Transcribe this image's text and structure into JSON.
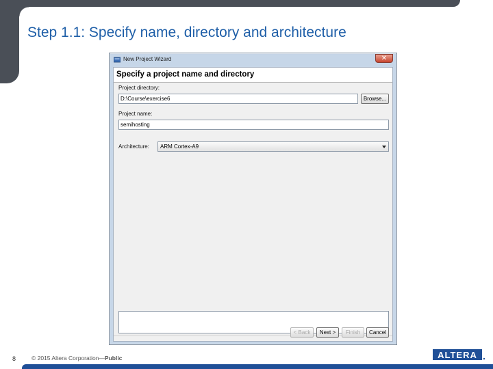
{
  "slide": {
    "title": "Step 1.1: Specify name, directory and architecture",
    "page_number": "8",
    "copyright_prefix": "© 2015 Altera Corporation—",
    "copyright_bold": "Public",
    "logo_text": "ALTERA"
  },
  "window": {
    "title": "New Project Wizard",
    "close_glyph": "✕",
    "header": "Specify a project name and directory",
    "project_directory_label": "Project directory:",
    "project_directory_value": "D:\\Course\\exercise6",
    "browse_label": "Browse...",
    "project_name_label": "Project name:",
    "project_name_value": "semihosting",
    "architecture_label": "Architecture:",
    "architecture_value": "ARM Cortex-A9",
    "buttons": {
      "back": "< Back",
      "next": "Next >",
      "finish": "Finish",
      "cancel": "Cancel"
    }
  },
  "colors": {
    "title_blue": "#1f5fa8",
    "chrome_gray": "#4a4f57",
    "footer_blue": "#1f4f97"
  }
}
